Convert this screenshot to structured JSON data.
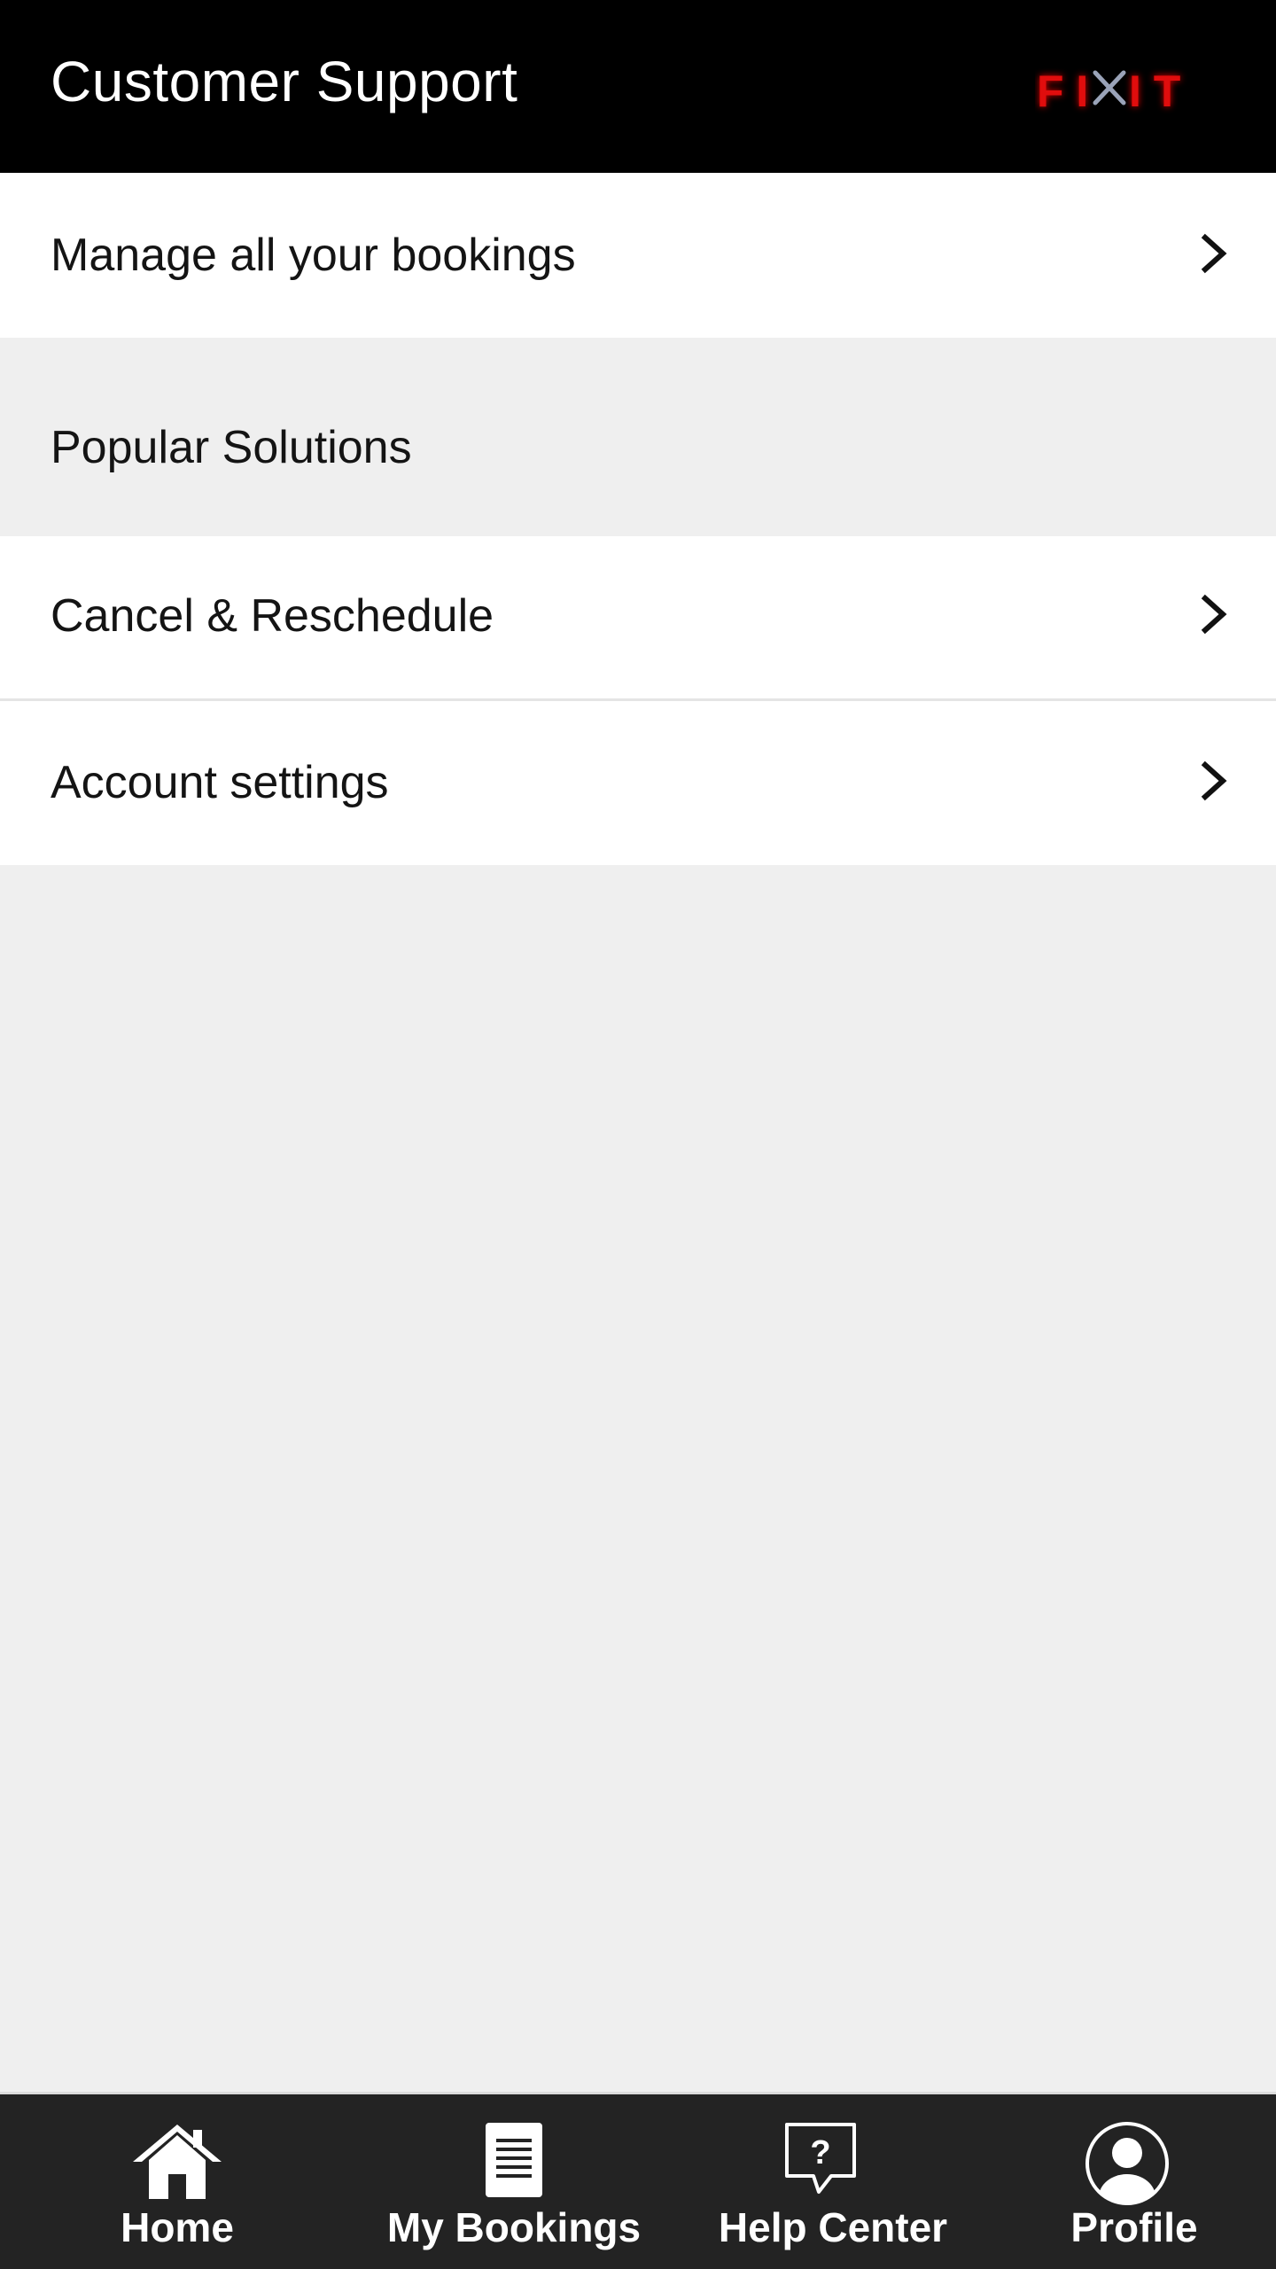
{
  "app_bar": {
    "title": "Customer Support",
    "logo_text": "FIXIT",
    "logo_color": "#e01010"
  },
  "rows": {
    "manage_bookings": {
      "label": "Manage all your bookings",
      "icon": "chevron-right-icon"
    },
    "popular_solutions": {
      "label": "Popular Solutions"
    },
    "cancel_reschedule": {
      "label": "Cancel & Reschedule",
      "icon": "chevron-right-icon"
    },
    "account_settings": {
      "label": "Account settings",
      "icon": "chevron-right-icon"
    }
  },
  "bottom_nav": {
    "items": [
      {
        "label": "Home",
        "icon": "home-icon"
      },
      {
        "label": "My Bookings",
        "icon": "document-icon"
      },
      {
        "label": "Help Center",
        "icon": "help-chat-icon"
      },
      {
        "label": "Profile",
        "icon": "user-circle-icon"
      }
    ],
    "background": "#232323"
  },
  "colors": {
    "app_bar": "#000000",
    "page_background": "#efefef",
    "row_background": "#ffffff",
    "text": "#141414"
  }
}
